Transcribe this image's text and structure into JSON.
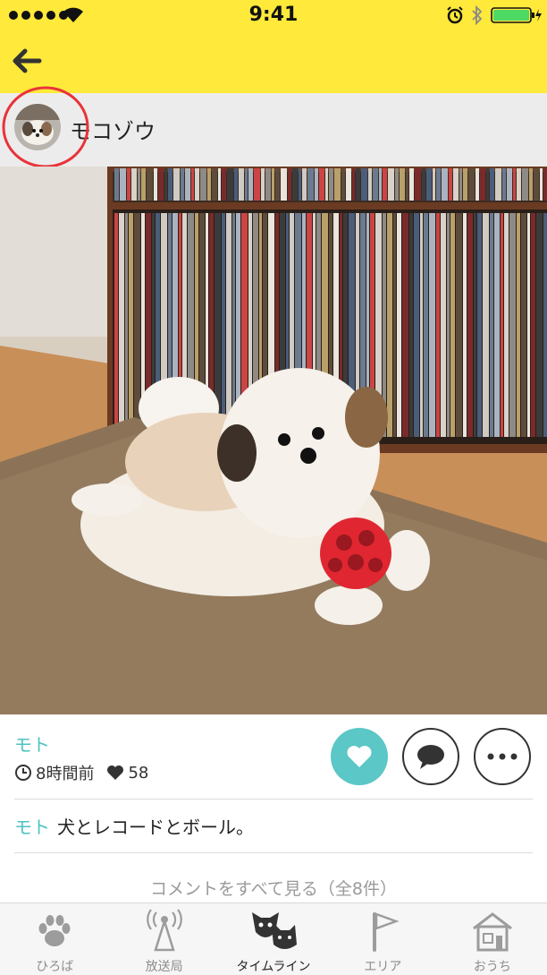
{
  "status_bar": {
    "time": "9:41"
  },
  "nav": {
    "back_icon": "back-arrow-icon"
  },
  "user": {
    "name": "モコゾウ"
  },
  "post": {
    "author": "モト",
    "time_ago": "8時間前",
    "likes": "58",
    "caption_author": "モト",
    "caption": "犬とレコードとボール。",
    "see_all": "コメントをすべて見る（全8件）",
    "liked": true
  },
  "tabs": [
    {
      "label": "ひろば",
      "icon": "paw-icon",
      "active": false
    },
    {
      "label": "放送局",
      "icon": "broadcast-tower-icon",
      "active": false
    },
    {
      "label": "タイムライン",
      "icon": "dog-cat-icon",
      "active": true
    },
    {
      "label": "エリア",
      "icon": "flag-icon",
      "active": false
    },
    {
      "label": "おうち",
      "icon": "house-icon",
      "active": false
    }
  ],
  "colors": {
    "nav_bar": "#ffe93a",
    "accent": "#4ec3c3",
    "like_button": "#5bc7c6",
    "annotation": "#e8333a"
  }
}
